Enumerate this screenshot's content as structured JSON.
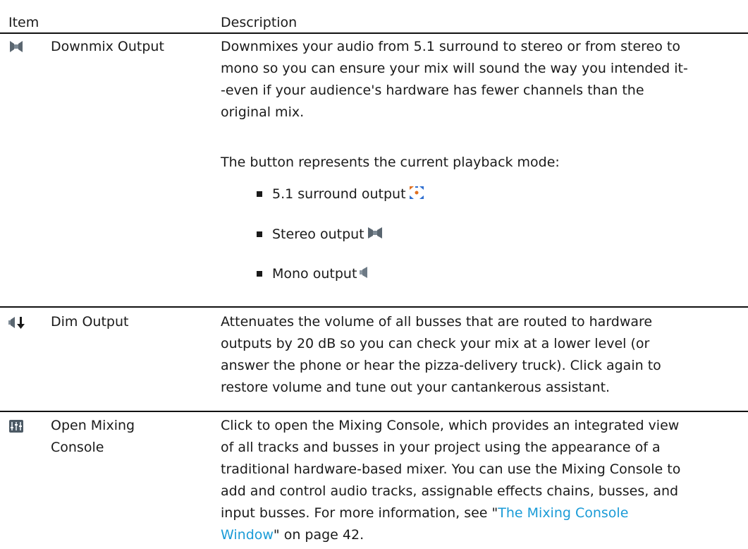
{
  "header": {
    "item": "Item",
    "description": "Description"
  },
  "rows": [
    {
      "icon": "downmix-output-icon",
      "item": "Downmix Output",
      "description_lines": [
        "Downmixes your audio from 5.1 surround to stereo or from stereo to",
        "mono so you can ensure your mix will sound the way you intended it-",
        "-even if your audience's hardware has fewer channels than the",
        "original mix."
      ],
      "mode_intro": "The button represents the current playback mode:",
      "modes": [
        {
          "label": "5.1 surround output",
          "icon": "surround-output-icon"
        },
        {
          "label": "Stereo output",
          "icon": "stereo-output-icon"
        },
        {
          "label": "Mono output",
          "icon": "mono-output-icon"
        }
      ]
    },
    {
      "icon": "dim-output-icon",
      "item": "Dim Output",
      "description_lines": [
        "Attenuates the volume of all busses that are routed to hardware",
        "outputs by 20 dB so you can check your mix at a lower level (or",
        "answer the phone or hear the pizza-delivery truck). Click again to",
        "restore volume and tune out your cantankerous assistant."
      ]
    },
    {
      "icon": "mixing-console-icon",
      "item_lines": [
        "Open Mixing",
        "Console"
      ],
      "description_lines": [
        "Click to open the Mixing Console, which provides an integrated view",
        "of all tracks and busses in your project using the appearance of a",
        "traditional hardware-based mixer. You can use the Mixing Console to",
        "add and control audio tracks, assignable effects chains, busses, and",
        "input busses. For more information, see \""
      ],
      "link_line1": "The Mixing Console",
      "link_line2": "Window",
      "after_link": "\" on page 42."
    }
  ],
  "colors": {
    "link": "#1a9bd7",
    "icon_gray": "#5a6670",
    "surround_orange": "#e07020",
    "surround_blue": "#2f6fd0"
  }
}
